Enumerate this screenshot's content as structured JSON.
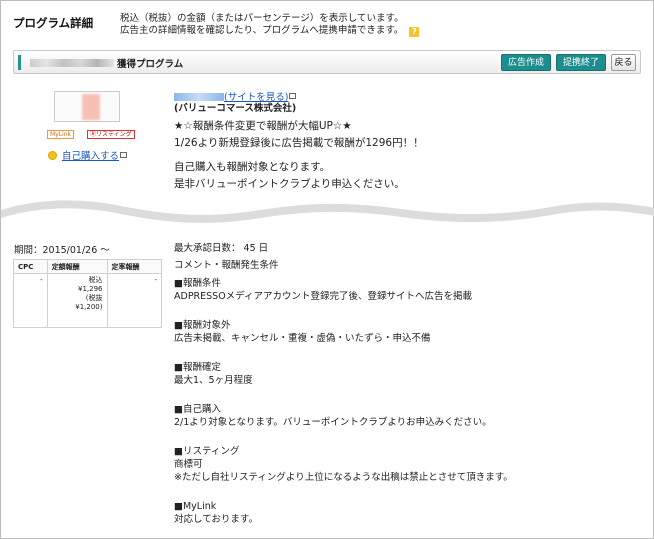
{
  "page": {
    "title": "プログラム詳細",
    "description_line1": "税込（税抜）の金額（またはパーセンテージ）を表示しています。",
    "description_line2": "広告主の詳細情報を確認したり、プログラムへ提携申請できます。",
    "help_icon": "?"
  },
  "program_bar": {
    "name_suffix": "獲得プログラム",
    "buttons": {
      "create_ad": "広告作成",
      "end_partnership": "提携終了",
      "back": "戻る"
    }
  },
  "sidebar": {
    "badges": {
      "mylink": "MyLink",
      "listing": "Ⓡリスティング"
    },
    "self_purchase_link": "自己購入する"
  },
  "site": {
    "view_site_link": "(サイトを見る)",
    "company": "(バリューコマース株式会社)"
  },
  "promo": {
    "line1": "★☆報酬条件変更で報酬が大幅UP☆★",
    "line2": "1/26より新規登録後に広告掲載で報酬が1296円！！",
    "line3": "自己購入も報酬対象となります。",
    "line4": "是非バリューポイントクラブより申込ください。"
  },
  "reward": {
    "period": "期間：2015/01/26 ～",
    "table": {
      "headers": [
        "CPC",
        "定額報酬",
        "定率報酬"
      ],
      "cpc": "-",
      "fixed_line1": "税込",
      "fixed_line2": "¥1,296",
      "fixed_line3": "(税抜",
      "fixed_line4": "¥1,200)",
      "rate": "-"
    }
  },
  "conditions": {
    "max_approval": "最大承認日数： 45 日",
    "comment_heading": "コメント・報酬発生条件",
    "reward_condition_heading": "■報酬条件",
    "reward_condition_text": "ADPRESSOメディアアカウント登録完了後、登録サイトへ広告を掲載",
    "exclusion_heading": "■報酬対象外",
    "exclusion_text": "広告未掲載、キャンセル・重複・虚偽・いたずら・申込不備",
    "confirm_heading": "■報酬確定",
    "confirm_text": "最大1、5ヶ月程度",
    "self_heading": "■自己購入",
    "self_text": "2/1より対象となります。バリューポイントクラブよりお申込みください。",
    "listing_heading": "■リスティング",
    "listing_text1": "商標可",
    "listing_text2": "※ただし自社リスティングより上位になるような出稿は禁止とさせて頂きます。",
    "mylink_heading": "■MyLink",
    "mylink_text": "対応しております。"
  },
  "colors": {
    "accent_teal": "#1d8d8d",
    "link_blue": "#1a55c7",
    "help_yellow": "#f3c42b"
  }
}
